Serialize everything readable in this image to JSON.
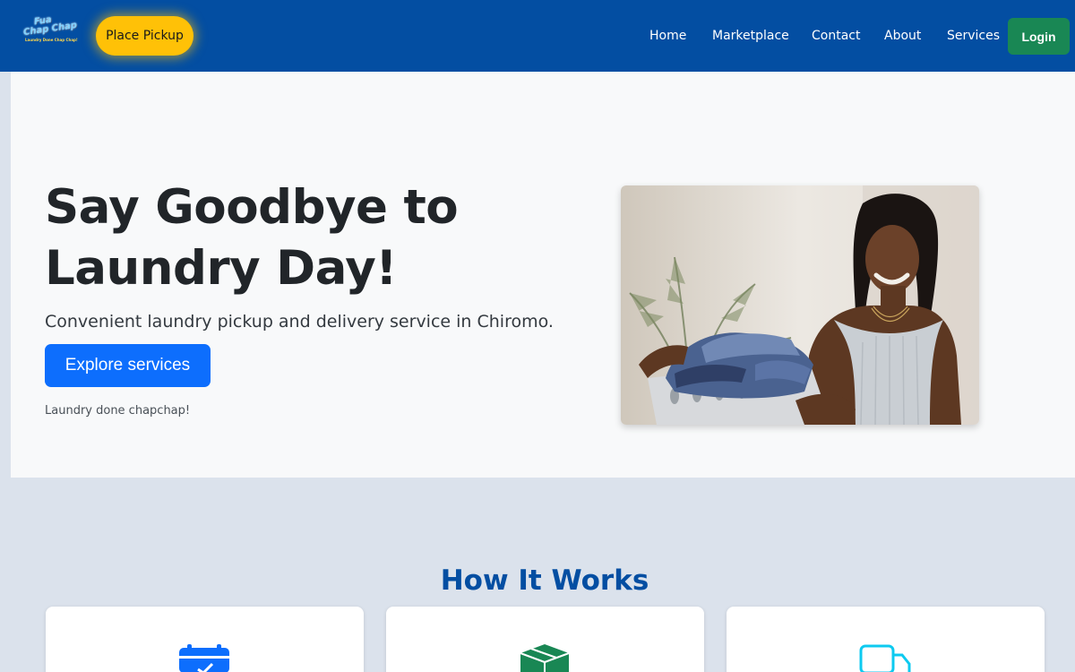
{
  "navbar": {
    "logo": {
      "line1": "Fua",
      "line2": "Chap Chap",
      "line3": "Laundry Done Chap Chap!"
    },
    "pickup_label": "Place Pickup",
    "links": [
      "Home",
      "Marketplace",
      "Contact",
      "About",
      "Services"
    ],
    "login_label": "Login"
  },
  "hero": {
    "title": "Say Goodbye to Laundry Day!",
    "subtitle": "Convenient laundry pickup and delivery service in Chiromo.",
    "cta_label": "Explore services",
    "tagline": "Laundry done chapchap!"
  },
  "how_it_works": {
    "title": "How It Works",
    "cards": [
      {
        "icon": "calendar-check-icon",
        "color": "#0d6efd"
      },
      {
        "icon": "box-icon",
        "color": "#198754"
      },
      {
        "icon": "truck-icon",
        "color": "#0dcaf0"
      }
    ]
  },
  "colors": {
    "navbar": "#034ea2",
    "pickup": "#ffc107",
    "login": "#198754",
    "primary": "#0d6efd",
    "heading_blue": "#034ea2"
  }
}
